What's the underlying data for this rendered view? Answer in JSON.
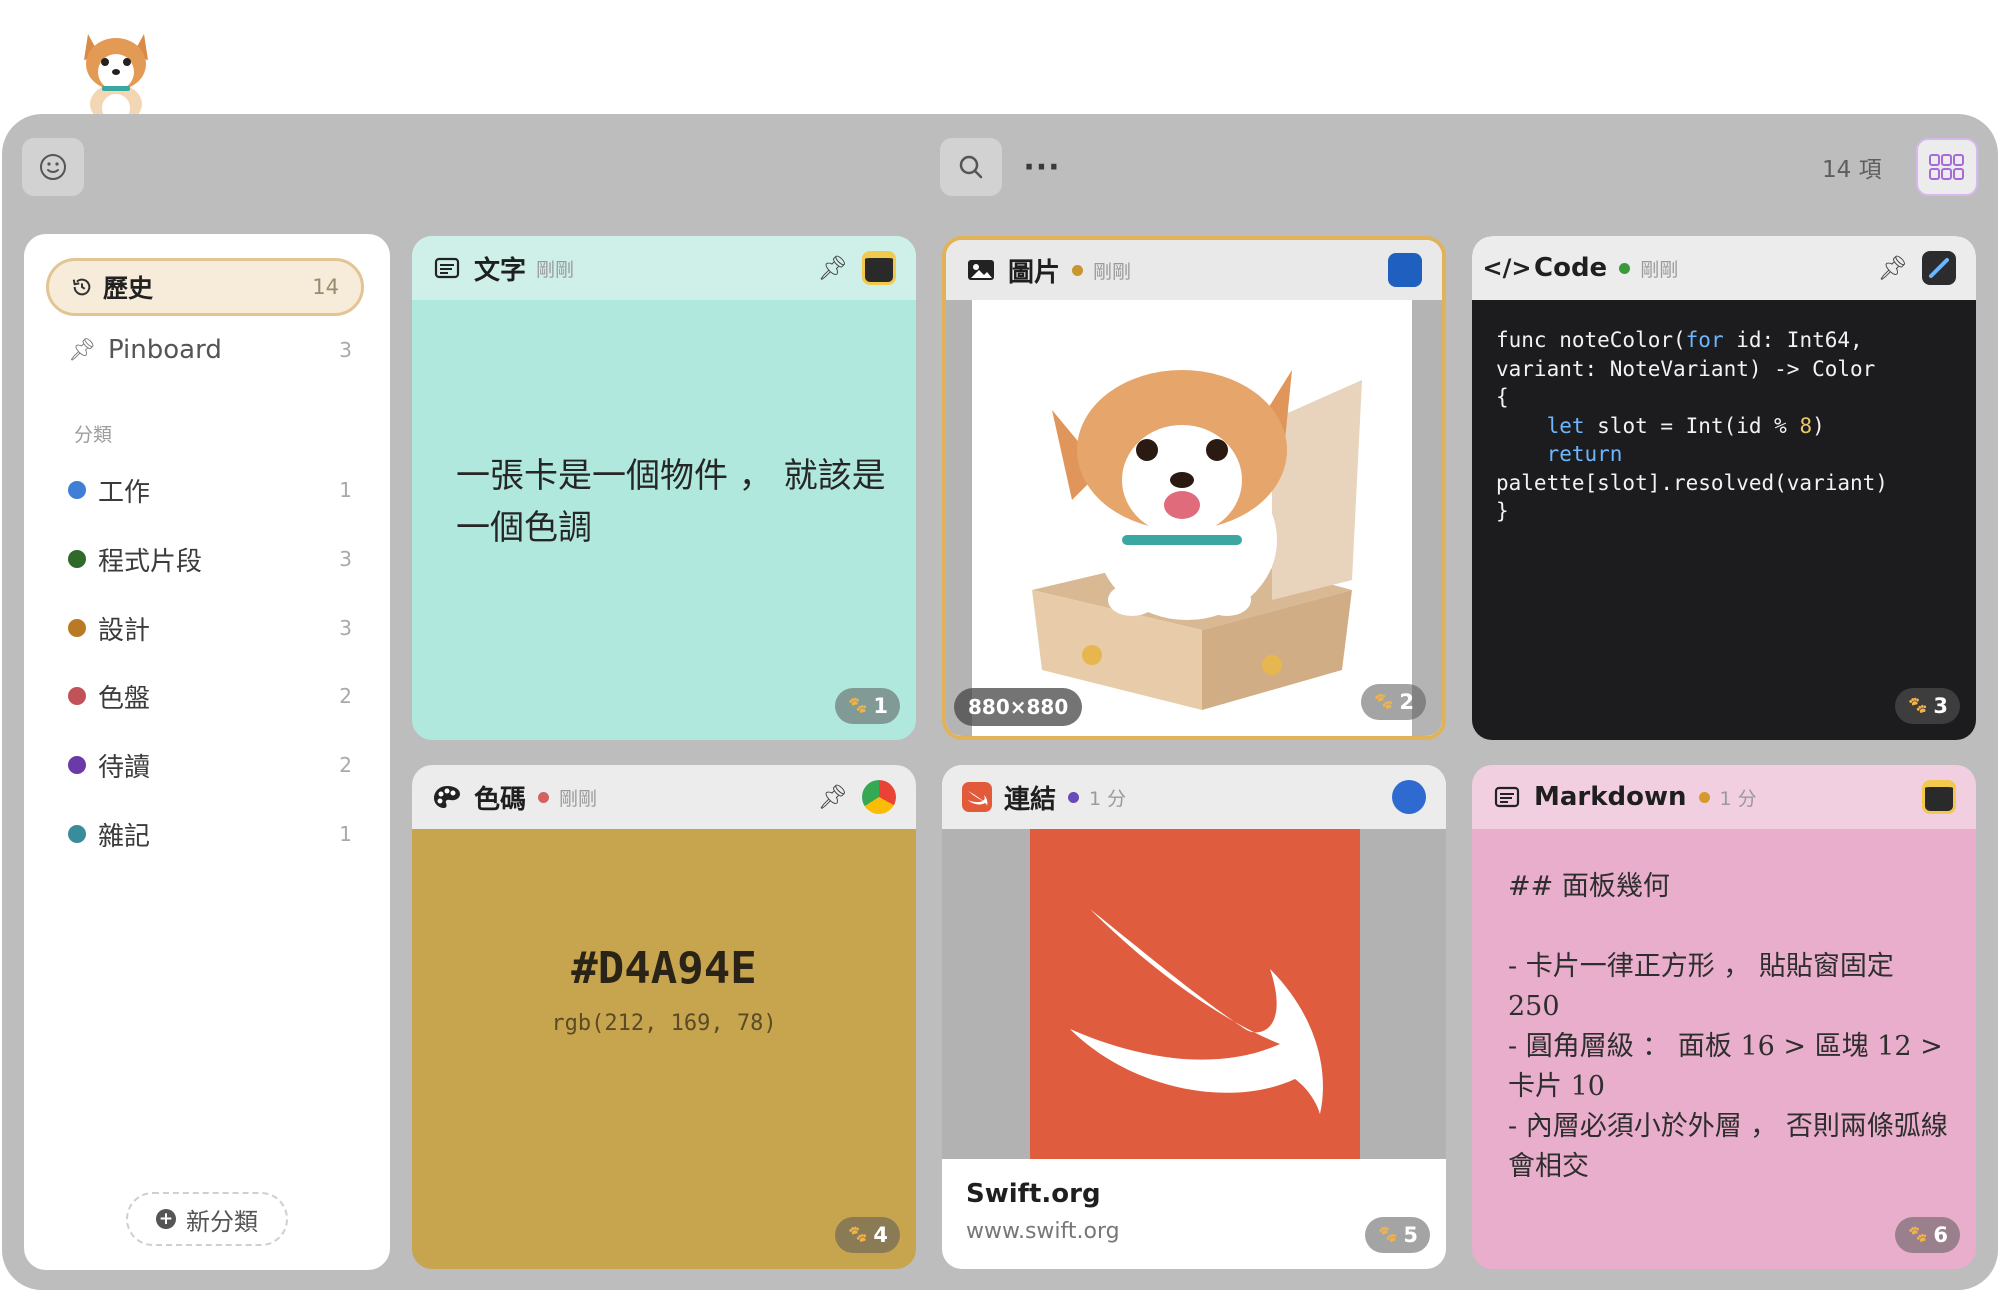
{
  "toolbar": {
    "item_count": "14 項"
  },
  "sidebar": {
    "history": {
      "label": "歷史",
      "count": "14"
    },
    "pinboard": {
      "label": "Pinboard",
      "count": "3"
    },
    "section_label": "分類",
    "categories": [
      {
        "label": "工作",
        "count": "1",
        "color": "#3f7fd6"
      },
      {
        "label": "程式片段",
        "count": "3",
        "color": "#2f6a2b"
      },
      {
        "label": "設計",
        "count": "3",
        "color": "#b97a26"
      },
      {
        "label": "色盤",
        "count": "2",
        "color": "#c2525a"
      },
      {
        "label": "待讀",
        "count": "2",
        "color": "#6b3aa8"
      },
      {
        "label": "雜記",
        "count": "1",
        "color": "#3a8c9a"
      }
    ],
    "new_category": "新分類"
  },
  "cards": {
    "text": {
      "title": "文字",
      "time": "剛剛",
      "content": "一張卡是一個物件 ， 就該是一個色調",
      "badge": "1"
    },
    "image": {
      "title": "圖片",
      "time": "剛剛",
      "status_color": "#c9952f",
      "dims": "880×880",
      "badge": "2"
    },
    "code": {
      "title": "Code",
      "time": "剛剛",
      "status_color": "#3a9a3a",
      "badge": "3"
    },
    "color": {
      "title": "色碼",
      "time": "剛剛",
      "status_color": "#d26262",
      "hex": "#D4A94E",
      "rgb": "rgb(212, 169, 78)",
      "badge": "4"
    },
    "link": {
      "title": "連結",
      "time": "1 分",
      "status_color": "#6a4ab8",
      "link_title": "Swift.org",
      "url": "www.swift.org",
      "badge": "5"
    },
    "markdown": {
      "title": "Markdown",
      "time": "1 分",
      "status_color": "#d49a2e",
      "heading": "## 面板幾何",
      "lines": [
        "- 卡片一律正方形 ， 貼貼窗固定 250",
        "- 圓角層級 ： 面板 16 > 區塊 12 > 卡片 10",
        "- 內層必須小於外層 ， 否則兩條弧線會相交"
      ],
      "badge": "6"
    }
  }
}
